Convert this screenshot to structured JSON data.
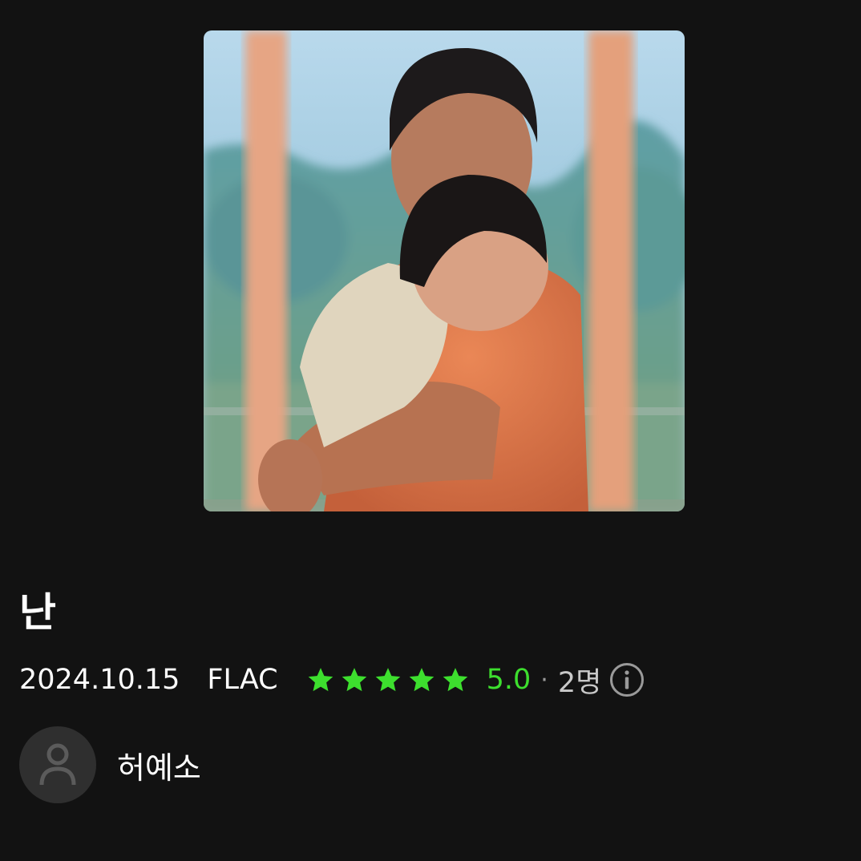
{
  "album": {
    "cover_alt": "album-cover",
    "title": "난",
    "release_date": "2024.10.15",
    "format": "FLAC",
    "rating_value": 5.0,
    "rating_text": "5.0",
    "rating_max": 5,
    "separator": "·",
    "rater_count": "2명"
  },
  "artist": {
    "name": "허예소",
    "avatar_icon": "person-icon"
  },
  "icons": {
    "star": "star-icon",
    "info": "info-icon"
  },
  "colors": {
    "background": "#121212",
    "rating_green": "#3ddf2e",
    "muted": "#9a9a9a"
  }
}
